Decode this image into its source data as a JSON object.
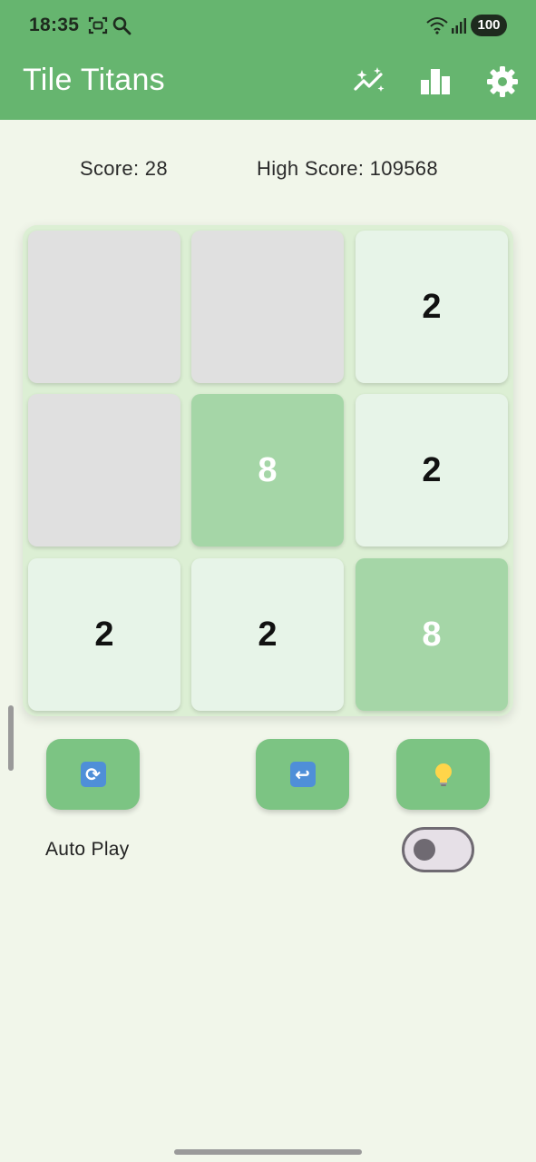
{
  "status_bar": {
    "time": "18:35",
    "battery": "100",
    "icons": [
      "screenshot-icon",
      "search-icon",
      "wifi-icon",
      "signal-icon",
      "battery-icon"
    ]
  },
  "app_bar": {
    "title": "Tile Titans",
    "actions": [
      "auto-awesome-icon",
      "leaderboard-icon",
      "settings-icon"
    ],
    "color": "#66b56f"
  },
  "scores": {
    "score_text": "Score: 28",
    "high_score_text": "High Score: 109568"
  },
  "board": {
    "size": 3,
    "rows": [
      [
        "",
        "",
        "2"
      ],
      [
        "",
        "8",
        "2"
      ],
      [
        "2",
        "2",
        "8"
      ]
    ],
    "colors": {
      "empty": "#e0e0e0",
      "tile_2": "#e7f4e8",
      "tile_8": "#a5d6a7"
    }
  },
  "controls": {
    "buttons": [
      {
        "name": "restart-button",
        "icon": "refresh-icon"
      },
      {
        "name": "undo-button",
        "icon": "undo-icon"
      },
      {
        "name": "hint-button",
        "icon": "lightbulb-icon"
      }
    ],
    "color": "#7cc483"
  },
  "autoplay": {
    "label": "Auto Play",
    "enabled": false
  }
}
